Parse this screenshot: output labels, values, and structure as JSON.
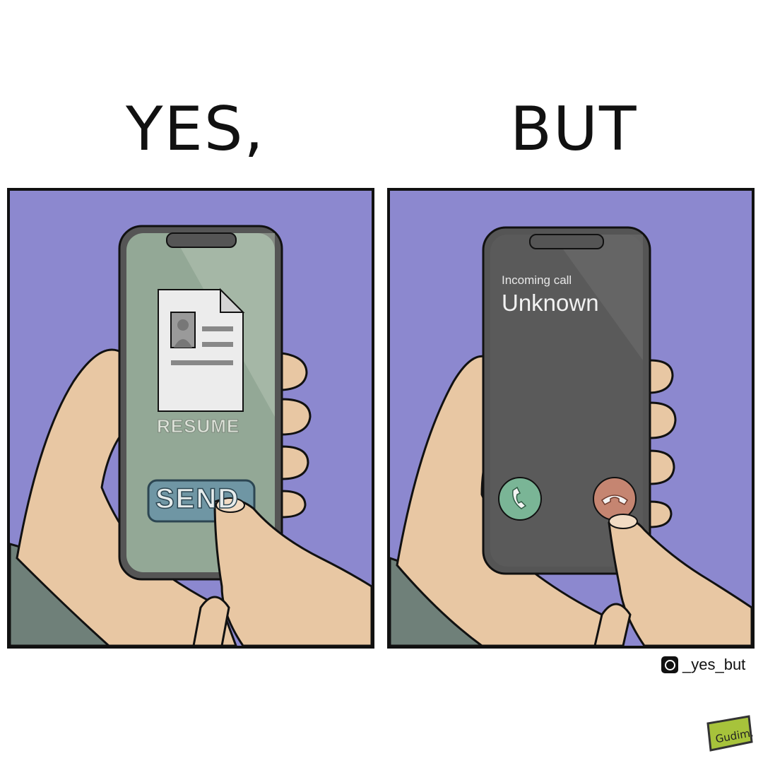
{
  "headings": {
    "left": "YES,",
    "right": "BUT"
  },
  "left_panel": {
    "document_label": "RESUME",
    "button_label": "SEND",
    "icons": [
      "resume-document-icon"
    ]
  },
  "right_panel": {
    "call_status": "Incoming call",
    "caller": "Unknown",
    "icons": [
      "accept-call-icon",
      "decline-call-icon"
    ]
  },
  "watermark": {
    "icon": "instagram-icon",
    "handle": "_yes_but"
  },
  "signature": {
    "text": "Gudim."
  },
  "colors": {
    "background": "#8c88cf",
    "skin": "#e8c7a3",
    "sleeve": "#6f8079",
    "phone_frame": "#555555",
    "left_screen": "#93a896",
    "send_button": "#6f96a4",
    "right_screen": "#5a5a5a",
    "accept_button": "#7ab596",
    "decline_button": "#c58571"
  }
}
